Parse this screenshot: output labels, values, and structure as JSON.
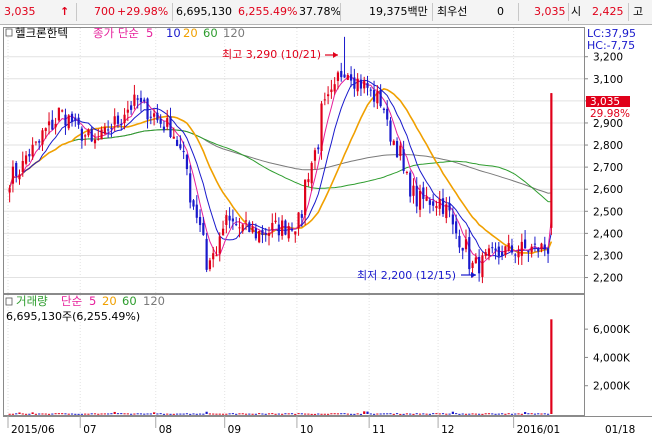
{
  "top_bar": {
    "price": "3,035",
    "change": "700",
    "change_pct": "+29.98%",
    "volume": "6,695,130",
    "volume_pct": "6,255.49%",
    "turnover_pct": "37.78%",
    "trade_value": "19,375백만",
    "preferred_label": "최우선",
    "preferred_value": "0",
    "ask": "3,035",
    "open_label": "시",
    "open_value": "2,425",
    "high_label": "고"
  },
  "price_panel": {
    "stock_name": "헬크론한텍",
    "ma_label": "종가 단순",
    "ma_periods": [
      "5",
      "10",
      "20",
      "60",
      "120"
    ],
    "lc_label": "LC:37,95",
    "hc_label": "HC:-7,75",
    "high_note": "최고 3,290 (10/21)",
    "low_note": "최저 2,200 (12/15)",
    "current_price_tag": "3,035",
    "current_pct_tag": "29.98%"
  },
  "volume_panel": {
    "title": "거래량",
    "ma_label": "단순",
    "ma_periods": [
      "5",
      "20",
      "60",
      "120"
    ],
    "current_volume": "6,695,130주(6,255.49%)"
  },
  "colors": {
    "up": "#e0001a",
    "down": "#1a1acc",
    "ma5": "#e6209b",
    "ma10": "#1a1acc",
    "ma20": "#f0a000",
    "ma60": "#2e9d2e",
    "ma120": "#7a7a7a"
  },
  "chart_data": [
    {
      "type": "candlestick",
      "title": "헬크론한텍",
      "price_axis": {
        "ticks": [
          2200,
          2300,
          2400,
          2500,
          2600,
          2700,
          2800,
          2900,
          3000,
          3100,
          3200
        ],
        "tick_labels": [
          "2,200",
          "2,300",
          "2,400",
          "2,500",
          "2,600",
          "2,700",
          "2,800",
          "2,900",
          "3,000",
          "3,100",
          "3,200"
        ],
        "range": [
          2130,
          3330
        ]
      },
      "x_tick_labels": [
        "2015/06",
        "07",
        "08",
        "09",
        "10",
        "11",
        "12",
        "2016/01",
        "01/18"
      ],
      "anchors": [
        {
          "date": "2015/06/01",
          "close": 2650
        },
        {
          "date": "2015/06/22",
          "close": 2950
        },
        {
          "date": "2015/07/06",
          "close": 2800
        },
        {
          "date": "2015/07/24",
          "close": 3000
        },
        {
          "date": "2015/08/10",
          "close": 2850
        },
        {
          "date": "2015/08/20",
          "close": 2450
        },
        {
          "date": "2015/08/24",
          "close": 2250
        },
        {
          "date": "2015/09/01",
          "close": 2450
        },
        {
          "date": "2015/09/14",
          "close": 2400
        },
        {
          "date": "2015/10/01",
          "close": 2450
        },
        {
          "date": "2015/10/12",
          "close": 2950
        },
        {
          "date": "2015/10/21",
          "close": 3150
        },
        {
          "date": "2015/11/05",
          "close": 3000
        },
        {
          "date": "2015/11/20",
          "close": 2550
        },
        {
          "date": "2015/12/01",
          "close": 2550
        },
        {
          "date": "2015/12/15",
          "close": 2250
        },
        {
          "date": "2015/12/28",
          "close": 2320
        },
        {
          "date": "2016/01/15",
          "close": 2335
        },
        {
          "date": "2016/01/18",
          "close": 3035
        }
      ],
      "extremes": {
        "high": {
          "value": 3290,
          "date": "10/21"
        },
        "low": {
          "value": 2200,
          "date": "12/15"
        }
      }
    },
    {
      "type": "bar",
      "title": "거래량",
      "y_ticks": [
        2000,
        4000,
        6000
      ],
      "y_tick_labels": [
        "2,000K",
        "4,000K",
        "6,000K"
      ],
      "unit": "K",
      "last_value": 6695130
    }
  ]
}
